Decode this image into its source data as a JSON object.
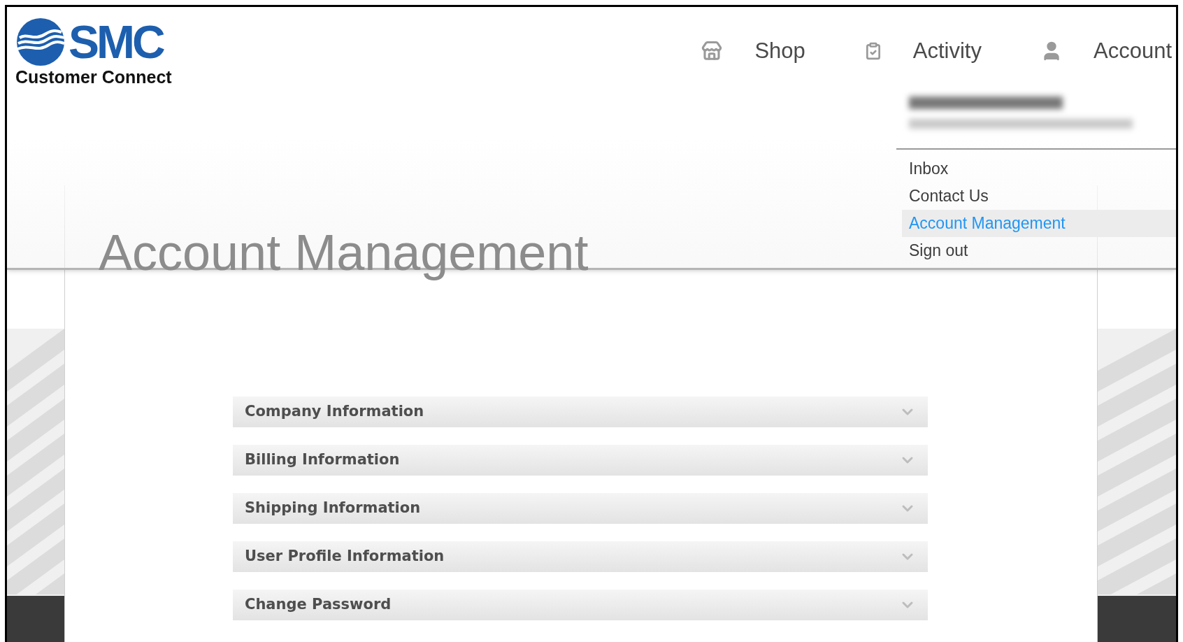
{
  "logo": {
    "brand": "SMC",
    "subtitle": "Customer Connect"
  },
  "nav": [
    {
      "kind": "shop",
      "label": "Shop"
    },
    {
      "kind": "activity",
      "label": "Activity"
    },
    {
      "kind": "account",
      "label": "Account"
    }
  ],
  "account_menu": {
    "items": [
      {
        "label": "Inbox",
        "selected": false
      },
      {
        "label": "Contact Us",
        "selected": false
      },
      {
        "label": "Account Management",
        "selected": true
      },
      {
        "label": "Sign out",
        "selected": false
      }
    ]
  },
  "page": {
    "title": "Account Management"
  },
  "sections": [
    {
      "label": "Company Information",
      "expanded": false
    },
    {
      "label": "Billing Information",
      "expanded": false
    },
    {
      "label": "Shipping Information",
      "expanded": false
    },
    {
      "label": "User Profile Information",
      "expanded": false
    },
    {
      "label": "Change Password",
      "expanded": false
    }
  ]
}
